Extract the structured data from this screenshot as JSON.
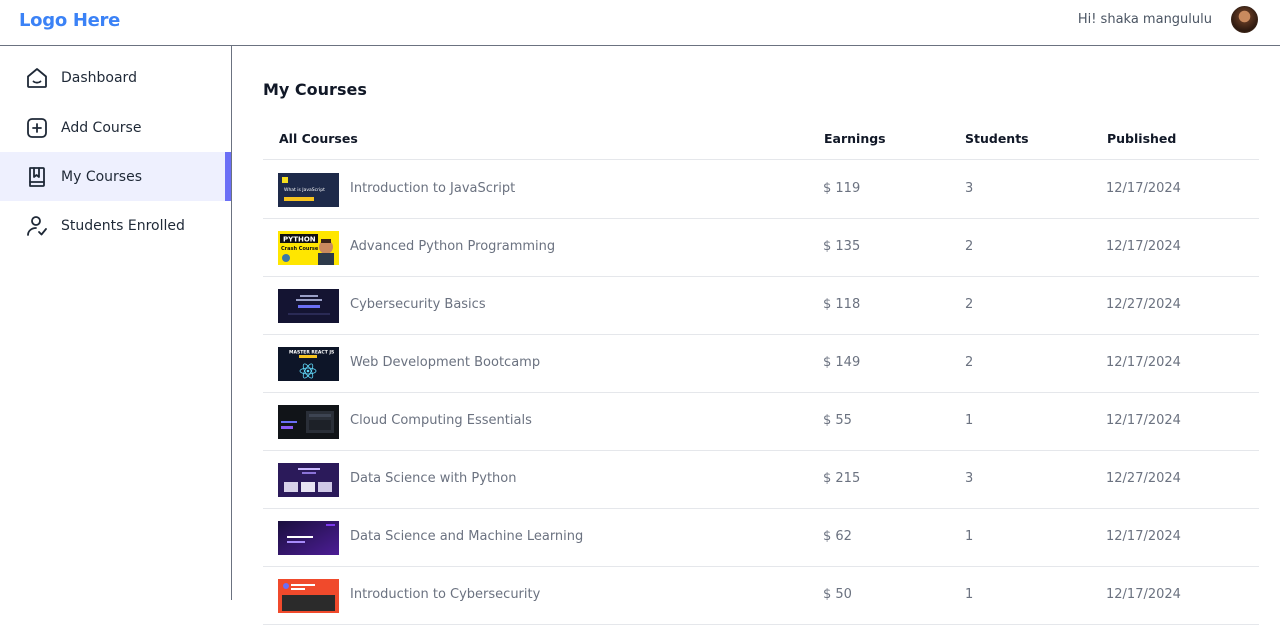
{
  "header": {
    "logo": "Logo Here",
    "greeting": "Hi! shaka mangululu"
  },
  "sidebar": {
    "items": [
      {
        "label": "Dashboard",
        "icon": "home-icon"
      },
      {
        "label": "Add Course",
        "icon": "add-square-icon"
      },
      {
        "label": "My Courses",
        "icon": "book-icon",
        "active": true
      },
      {
        "label": "Students Enrolled",
        "icon": "user-check-icon"
      }
    ]
  },
  "main": {
    "title": "My Courses",
    "columns": [
      "All Courses",
      "Earnings",
      "Students",
      "Published"
    ],
    "rows": [
      {
        "title": "Introduction to JavaScript",
        "earnings": "$ 119",
        "students": "3",
        "published": "12/17/2024",
        "thumb": "javascript-thumbnail"
      },
      {
        "title": "Advanced Python Programming",
        "earnings": "$ 135",
        "students": "2",
        "published": "12/17/2024",
        "thumb": "python-thumbnail"
      },
      {
        "title": "Cybersecurity Basics",
        "earnings": "$ 118",
        "students": "2",
        "published": "12/27/2024",
        "thumb": "cybersecurity-thumbnail"
      },
      {
        "title": "Web Development Bootcamp",
        "earnings": "$ 149",
        "students": "2",
        "published": "12/17/2024",
        "thumb": "react-thumbnail"
      },
      {
        "title": "Cloud Computing Essentials",
        "earnings": "$ 55",
        "students": "1",
        "published": "12/17/2024",
        "thumb": "cloud-thumbnail"
      },
      {
        "title": "Data Science with Python",
        "earnings": "$ 215",
        "students": "3",
        "published": "12/27/2024",
        "thumb": "data-science-thumbnail"
      },
      {
        "title": "Data Science and Machine Learning",
        "earnings": "$ 62",
        "students": "1",
        "published": "12/17/2024",
        "thumb": "ml-thumbnail"
      },
      {
        "title": "Introduction to Cybersecurity",
        "earnings": "$ 50",
        "students": "1",
        "published": "12/17/2024",
        "thumb": "intro-cyber-thumbnail"
      }
    ],
    "thumb_text": {
      "javascript": "What is JavaScript",
      "python_badge": "PYTHON",
      "python_sub": "Crash Course",
      "react": "MASTER REACT JS"
    }
  },
  "colors": {
    "brand": "#3b82f6",
    "active_bg": "#eef0fe",
    "active_bar": "#6b6ff6"
  }
}
